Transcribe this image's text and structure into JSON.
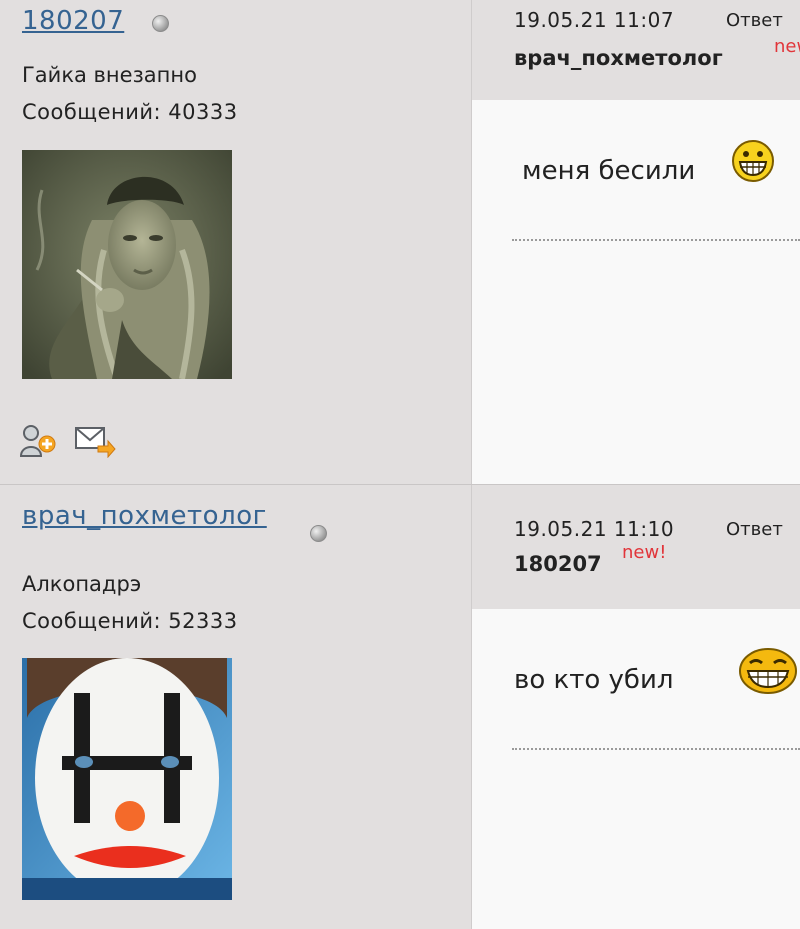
{
  "posts": [
    {
      "username": "180207",
      "rank": "Гайка внезапно",
      "messages_text": "Сообщений: 40333",
      "date": "19.05.21 11:07",
      "reply_label": "Ответ",
      "reply_to": "врач_похметолог",
      "new_badge": "new",
      "text": "меня бесили"
    },
    {
      "username": "врач_похметолог",
      "rank": "Алкопадрэ",
      "messages_text": "Сообщений: 52333",
      "date": "19.05.21 11:10",
      "reply_label": "Ответ",
      "reply_to": "180207",
      "new_badge": "new!",
      "text": "во кто убил"
    }
  ],
  "icons": {
    "add_friend": "add-friend-icon",
    "send_message": "envelope-icon",
    "status": "offline-status-dot-icon",
    "smiley_1": "grinning-smiley-icon",
    "smiley_2": "laughing-smiley-icon"
  },
  "colors": {
    "link": "#356391",
    "new_badge": "#e1353a",
    "panel": "#e2dfdf",
    "content_bg": "#f9f9f9"
  }
}
